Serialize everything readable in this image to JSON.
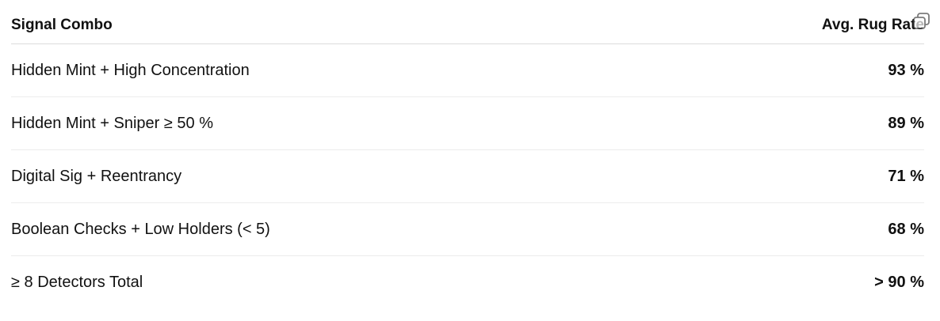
{
  "table": {
    "headers": {
      "signal": "Signal Combo",
      "rate": "Avg. Rug Rate"
    },
    "rows": [
      {
        "signal": "Hidden Mint + High Concentration",
        "rate": "93 %"
      },
      {
        "signal": "Hidden Mint + Sniper ≥ 50 %",
        "rate": "89 %"
      },
      {
        "signal": "Digital Sig + Reentrancy",
        "rate": "71 %"
      },
      {
        "signal": "Boolean Checks + Low Holders (< 5)",
        "rate": "68 %"
      },
      {
        "signal": "≥ 8 Detectors Total",
        "rate": "> 90 %"
      }
    ]
  },
  "icons": {
    "copy": "copy-icon"
  }
}
